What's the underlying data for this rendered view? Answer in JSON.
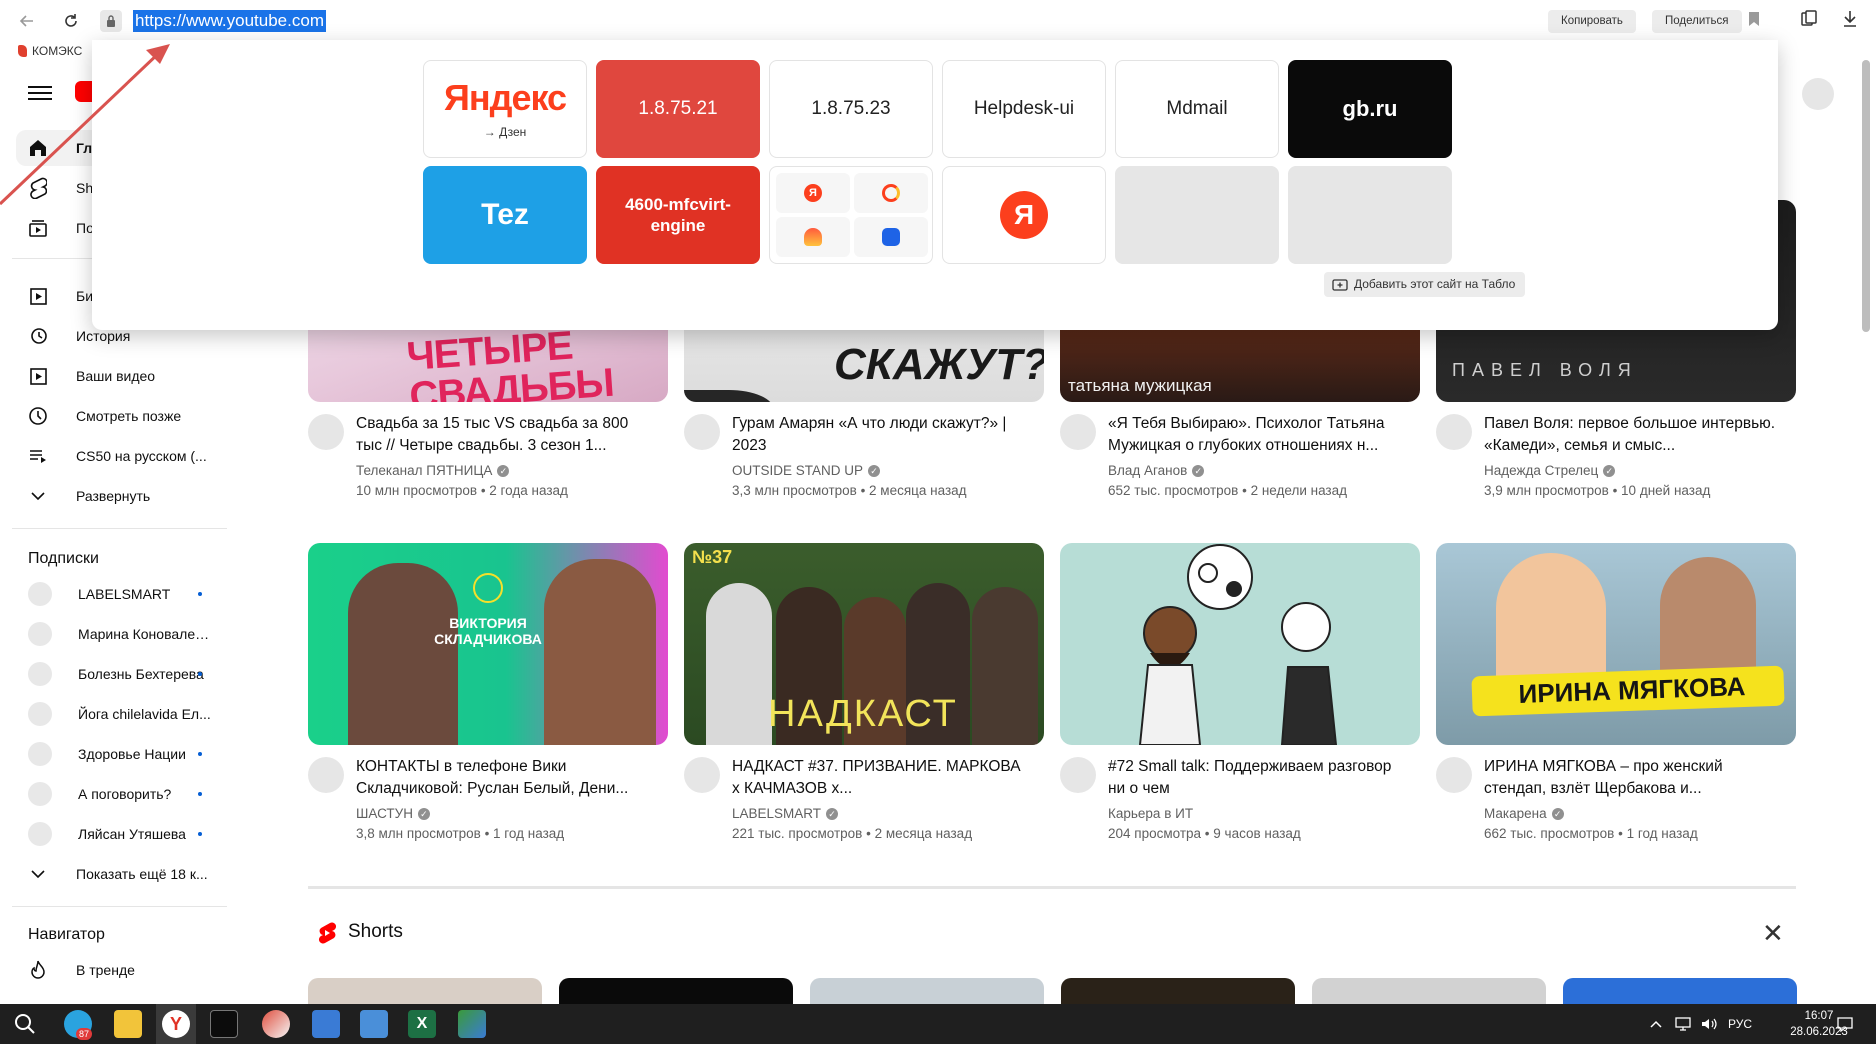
{
  "browser": {
    "url": "https://www.youtube.com",
    "copy_label": "Копировать",
    "share_label": "Поделиться",
    "bookmark_label": "КОМЭКС"
  },
  "tablo": {
    "tiles": [
      {
        "label": "Яндекс",
        "sub": "→ Дзен",
        "bg": "#ffffff",
        "color": "#000000"
      },
      {
        "label": "1.8.75.21",
        "bg": "#e0473e",
        "color": "#ffffff"
      },
      {
        "label": "1.8.75.23",
        "bg": "#ffffff",
        "color": "#222222"
      },
      {
        "label": "Helpdesk-ui",
        "bg": "#ffffff",
        "color": "#222222"
      },
      {
        "label": "Mdmail",
        "bg": "#ffffff",
        "color": "#222222"
      },
      {
        "label": "gb.ru",
        "bg": "#0a0a0a",
        "color": "#ffffff"
      },
      {
        "label": "Tez",
        "bg": "#1ea0e6",
        "color": "#ffffff"
      },
      {
        "label": "4600-mfcvirt-engine",
        "bg": "#e03224",
        "color": "#ffffff"
      }
    ],
    "add_label": "Добавить этот сайт на Табло"
  },
  "sidebar": {
    "top": [
      {
        "label": "Главная",
        "icon": "home-icon"
      },
      {
        "label": "Shorts",
        "icon": "shorts-icon"
      },
      {
        "label": "Подписки",
        "icon": "subscriptions-icon"
      }
    ],
    "library": [
      {
        "label": "Библиотека",
        "icon": "library-icon"
      },
      {
        "label": "История",
        "icon": "history-icon"
      },
      {
        "label": "Ваши видео",
        "icon": "your-videos-icon"
      },
      {
        "label": "Смотреть позже",
        "icon": "watch-later-icon"
      },
      {
        "label": "CS50 на русском (...",
        "icon": "playlist-icon"
      },
      {
        "label": "Развернуть",
        "icon": "chevron-down-icon"
      }
    ],
    "subscriptions_heading": "Подписки",
    "subscriptions": [
      {
        "label": "LABELSMART",
        "dot": true
      },
      {
        "label": "Марина Коноваленко",
        "dot": false
      },
      {
        "label": "Болезнь Бехтерева",
        "dot": true
      },
      {
        "label": "Йога chilelavida Ел...",
        "dot": false
      },
      {
        "label": "Здоровье Нации",
        "dot": true
      },
      {
        "label": "А поговорить?",
        "dot": true
      },
      {
        "label": "Ляйсан Утяшева",
        "dot": true
      }
    ],
    "show_more": "Показать ещё 18 к...",
    "navigator_heading": "Навигатор",
    "trending": "В тренде"
  },
  "videos": [
    {
      "title": "Свадьба за 15 тыс VS свадьба за 800 тыс // Четыре свадьбы. 3 сезон 1...",
      "channel": "Телеканал ПЯТНИЦА",
      "meta": "10 млн просмотров • 2 года назад",
      "thumb_text": "ЧЕТЫРЕ СВАДЬБЫ"
    },
    {
      "title": "Гурам Амарян «А что люди скажут?» | 2023",
      "channel": "OUTSIDE STAND UP",
      "meta": "3,3 млн просмотров • 2 месяца назад",
      "thumb_text": "СКАЖУТ?"
    },
    {
      "title": "«Я Тебя Выбираю». Психолог Татьяна Мужицкая о глубоких отношениях н...",
      "channel": "Влад Аганов",
      "meta": "652 тыс. просмотров • 2 недели назад",
      "thumb_text": "татьяна мужицкая"
    },
    {
      "title": "Павел Воля: первое большое интервью. «Камеди», семья и смыс...",
      "channel": "Надежда Стрелец",
      "meta": "3,9 млн просмотров • 10 дней назад",
      "thumb_text": "ПАВЕЛ ВОЛЯ"
    },
    {
      "title": "КОНТАКТЫ в телефоне Вики Складчиковой: Руслан Белый, Дени...",
      "channel": "ШАСТУН",
      "meta": "3,8 млн просмотров • 1 год назад",
      "thumb_text": "ВИКТОРИЯ СКЛАДЧИКОВА"
    },
    {
      "title": "НАДКАСТ #37. ПРИЗВАНИЕ. МАРКОВА х КАЧМАЗОВ х...",
      "channel": "LABELSMART",
      "meta": "221 тыс. просмотров • 2 месяца назад",
      "thumb_text": "НАДКАСТ"
    },
    {
      "title": "#72 Small talk: Поддерживаем разговор ни о чем",
      "channel": "Карьера в ИТ",
      "meta": "204 просмотра • 9 часов назад",
      "thumb_text": ""
    },
    {
      "title": "ИРИНА МЯГКОВА – про женский стендап, взлёт Щербакова и...",
      "channel": "Макарена",
      "meta": "662 тыс. просмотров • 1 год назад",
      "thumb_text": "ИРИНА МЯГКОВА"
    }
  ],
  "shorts": {
    "title": "Shorts"
  },
  "taskbar": {
    "lang": "РУС",
    "time": "16:07",
    "date": "28.06.2023",
    "badge": "87"
  }
}
